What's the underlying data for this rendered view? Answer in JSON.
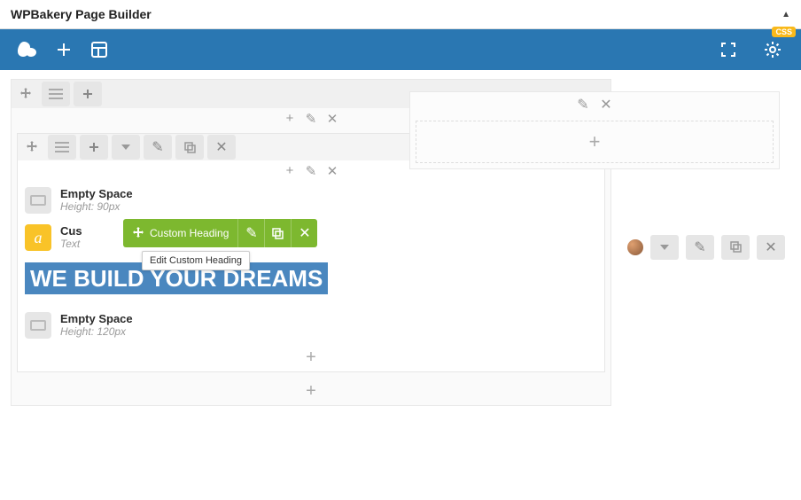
{
  "titlebar": {
    "title": "WPBakery Page Builder"
  },
  "css_badge": "CSS",
  "green_toolbar": {
    "label": "Custom Heading",
    "tooltip": "Edit Custom Heading"
  },
  "elements": {
    "empty1": {
      "title": "Empty Space",
      "sub": "Height: 90px"
    },
    "heading": {
      "title": "Cus",
      "sub": "Text"
    },
    "empty2": {
      "title": "Empty Space",
      "sub": "Height: 120px"
    }
  },
  "heading_text": " WE BUILD YOUR DREAMS"
}
